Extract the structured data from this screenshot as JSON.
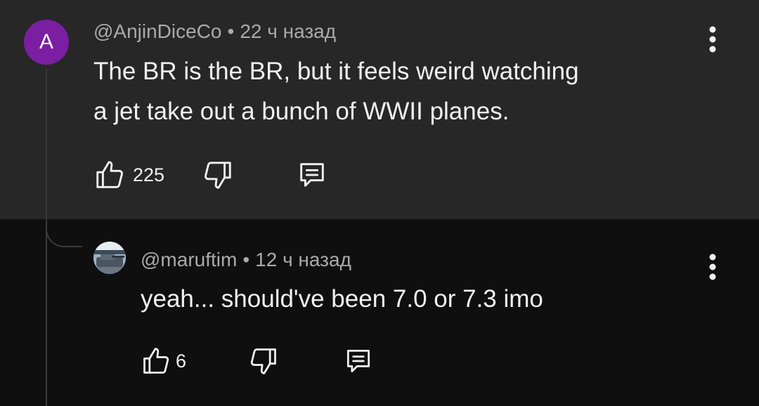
{
  "comments": [
    {
      "avatar_letter": "A",
      "author": "@AnjinDiceCo",
      "time": "22 ч назад",
      "text_lines": [
        "The BR is the BR, but it feels weird watching",
        "a jet take out a bunch of WWII planes."
      ],
      "likes": "225",
      "avatar_color": "#7b1fa2"
    },
    {
      "author": "@maruftim",
      "time": "12 ч назад",
      "text_lines": [
        "yeah... should've been 7.0 or 7.3 imo"
      ],
      "likes": "6"
    }
  ],
  "separator": "•",
  "icons": {
    "like": "thumb-up-icon",
    "dislike": "thumb-down-icon",
    "reply": "reply-comment-icon",
    "menu": "more-vertical-icon"
  },
  "colors": {
    "top_background": "#272727",
    "reply_background": "#0f0f0f",
    "meta_text": "#aaaaaa",
    "body_text": "#f1f1f1"
  }
}
